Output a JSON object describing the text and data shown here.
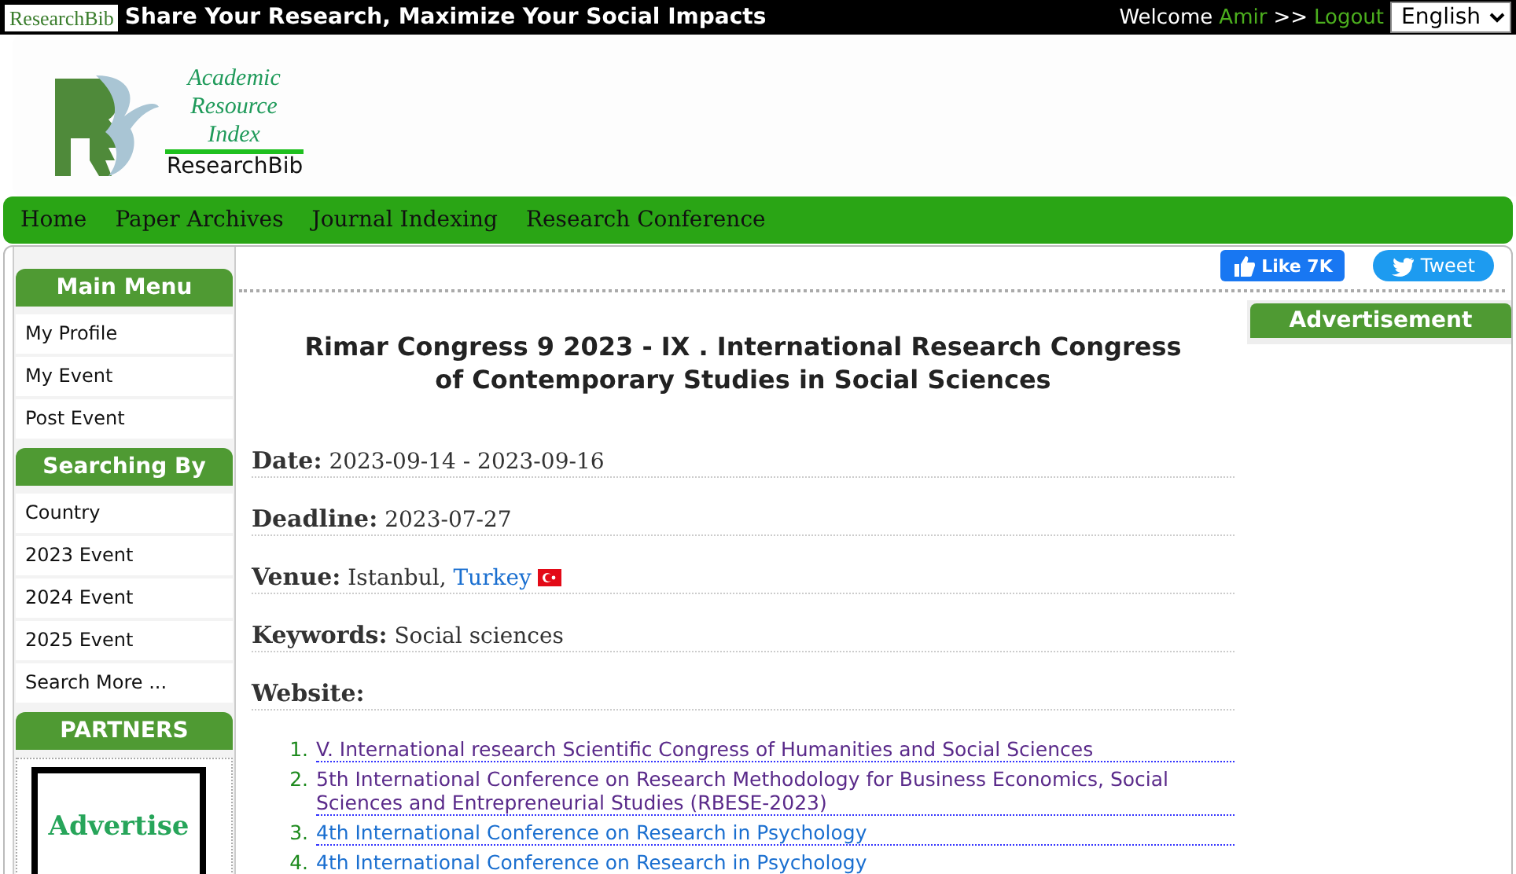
{
  "top_bar": {
    "logo_badge": "ResearchBib",
    "slogan": "Share Your Research, Maximize Your Social Impacts",
    "welcome": "Welcome",
    "user": "Amir",
    "separator": ">>",
    "logout": "Logout",
    "language": "English"
  },
  "header": {
    "logo_lines": [
      "Academic",
      "Resource",
      "Index"
    ],
    "logo_name": "ResearchBib"
  },
  "nav": [
    "Home",
    "Paper Archives",
    "Journal Indexing",
    "Research Conference"
  ],
  "sidebar": [
    {
      "kind": "menu",
      "title": "Main Menu",
      "items": [
        "My Profile",
        "My Event",
        "Post Event"
      ]
    },
    {
      "kind": "menu",
      "title": "Searching By",
      "items": [
        "Country",
        "2023 Event",
        "2024 Event",
        "2025 Event",
        "Search More ..."
      ]
    },
    {
      "kind": "ad",
      "title": "PARTNERS",
      "ad_text": "Advertise"
    }
  ],
  "social": {
    "like": "Like 7K",
    "tweet": "Tweet"
  },
  "event": {
    "title": "Rimar Congress 9 2023 - IX . International Research Congress of Contemporary Studies in Social Sciences",
    "details": [
      {
        "kind": "plain",
        "text": "**Date:** 2023-09-14 - 2023-09-16"
      },
      {
        "kind": "plain",
        "text": "**Deadline:** 2023-07-27"
      },
      {
        "kind": "country",
        "text": "**Venue:** Istanbul,",
        "link": "Turkey"
      },
      {
        "kind": "plain",
        "text": "**Keywords:** Social sciences"
      },
      {
        "kind": "plain",
        "text": "**Website:**"
      }
    ],
    "related": [
      {
        "number": "1.",
        "title": "V. International research Scientific Congress of Humanities and Social Sciences",
        "visited": true
      },
      {
        "number": "2.",
        "title": "5th International Conference on Research Methodology for Business Economics, Social Sciences and Entrepreneurial Studies (RBESE-2023)",
        "visited": true
      },
      {
        "number": "3.",
        "title": "4th International Conference on Research in Psychology",
        "visited": false
      },
      {
        "number": "4.",
        "title": "4th International Conference on Research in Psychology",
        "visited": false
      }
    ]
  },
  "aside": {
    "title": "Advertisement"
  }
}
